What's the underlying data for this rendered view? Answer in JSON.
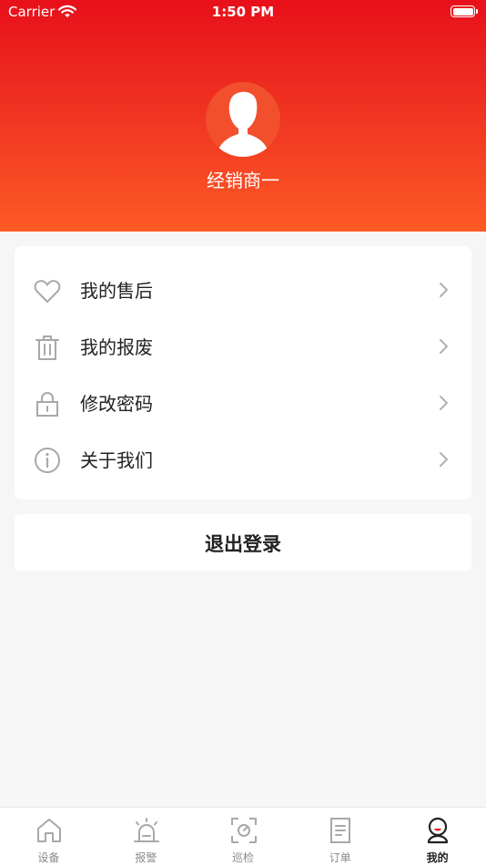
{
  "status_bar": {
    "carrier": "Carrier",
    "time": "1:50 PM"
  },
  "profile": {
    "name": "经销商一"
  },
  "menu": {
    "items": [
      {
        "label": "我的售后",
        "icon": "heart-icon"
      },
      {
        "label": "我的报废",
        "icon": "trash-icon"
      },
      {
        "label": "修改密码",
        "icon": "lock-icon"
      },
      {
        "label": "关于我们",
        "icon": "info-icon"
      }
    ]
  },
  "logout": {
    "label": "退出登录"
  },
  "tab_bar": {
    "tabs": [
      {
        "label": "设备",
        "icon": "home-icon",
        "active": false
      },
      {
        "label": "报警",
        "icon": "alarm-icon",
        "active": false
      },
      {
        "label": "巡检",
        "icon": "scan-icon",
        "active": false
      },
      {
        "label": "订单",
        "icon": "document-icon",
        "active": false
      },
      {
        "label": "我的",
        "icon": "user-icon",
        "active": true
      }
    ]
  },
  "colors": {
    "header_top": "#e8101a",
    "header_bottom": "#ff5a24",
    "background": "#f6f6f6",
    "icon_gray": "#a8a8a8",
    "active_accent": "#e8101a"
  }
}
